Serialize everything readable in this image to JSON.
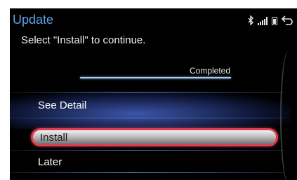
{
  "header": {
    "title": "Update",
    "subtitle": "Select \"Install\" to continue."
  },
  "status_bar": {
    "icons": [
      "bluetooth-icon",
      "signal-icon",
      "battery-icon",
      "back-icon"
    ]
  },
  "progress": {
    "label": "Completed",
    "fraction": 1.0
  },
  "menu": {
    "items": [
      {
        "label": "See Detail",
        "selected": false
      },
      {
        "label": "Install",
        "selected": true
      },
      {
        "label": "Later",
        "selected": false
      }
    ]
  },
  "colors": {
    "title": "#5fa3ea",
    "selection_border": "#e23b4e",
    "menu_highlight": "#4664c8"
  }
}
